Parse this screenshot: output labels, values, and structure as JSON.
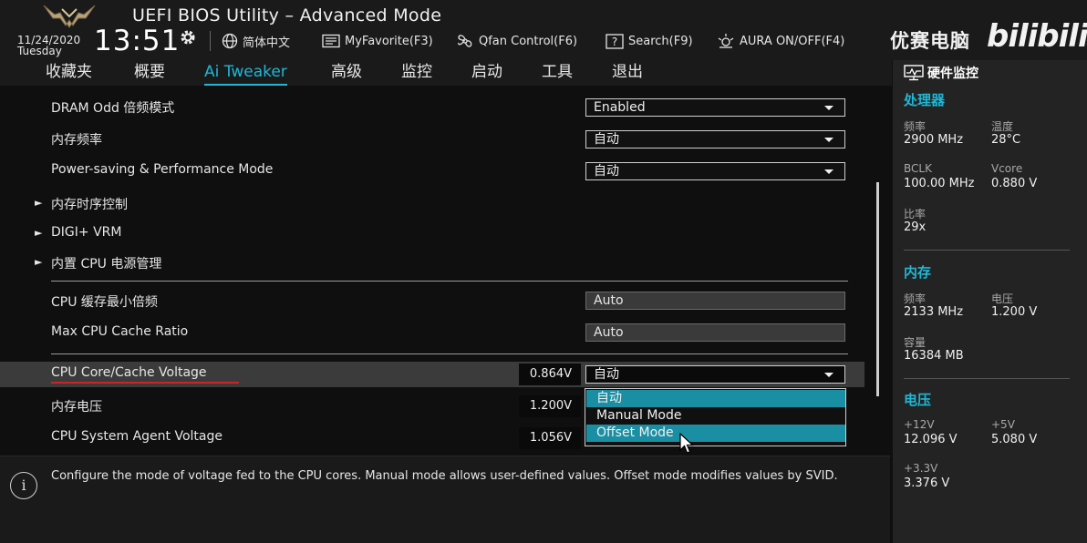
{
  "header": {
    "app_title": "UEFI BIOS Utility – Advanced Mode",
    "date": "11/24/2020",
    "day": "Tuesday",
    "time": "13:51",
    "toolbar": {
      "language": "简体中文",
      "favorite": "MyFavorite(F3)",
      "qfan": "Qfan Control(F6)",
      "search": "Search(F9)",
      "aura": "AURA ON/OFF(F4)"
    },
    "watermark": "优赛电脑",
    "watermark_brand": "bilibili"
  },
  "nav": {
    "tabs": [
      "收藏夹",
      "概要",
      "Ai Tweaker",
      "高级",
      "监控",
      "启动",
      "工具",
      "退出"
    ],
    "active": "Ai Tweaker"
  },
  "settings": {
    "dram_odd_label": "DRAM Odd 倍频模式",
    "dram_odd_value": "Enabled",
    "mem_freq_label": "内存频率",
    "mem_freq_value": "自动",
    "power_mode_label": "Power-saving & Performance Mode",
    "power_mode_value": "自动",
    "submenu_timing": "内存时序控制",
    "submenu_vrm": "DIGI+ VRM",
    "submenu_cpu_power": "内置 CPU 电源管理",
    "cpu_cache_min_label": "CPU 缓存最小倍频",
    "cpu_cache_min_value": "Auto",
    "max_cache_label": "Max CPU Cache Ratio",
    "max_cache_value": "Auto",
    "core_voltage_label": "CPU Core/Cache Voltage",
    "core_voltage_reading": "0.864V",
    "core_voltage_value": "自动",
    "mem_voltage_label": "内存电压",
    "mem_voltage_reading": "1.200V",
    "sa_voltage_label": "CPU System Agent Voltage",
    "sa_voltage_reading": "1.056V"
  },
  "popup": {
    "options": [
      "自动",
      "Manual Mode",
      "Offset Mode"
    ],
    "highlighted": [
      "自动",
      "Offset Mode"
    ]
  },
  "help": {
    "text": "Configure the mode of voltage fed to the CPU cores. Manual mode allows user-defined values. Offset mode modifies values by SVID."
  },
  "hw_monitor": {
    "title": "硬件监控",
    "cpu": {
      "title": "处理器",
      "freq_label": "频率",
      "freq_value": "2900 MHz",
      "temp_label": "温度",
      "temp_value": "28°C",
      "bclk_label": "BCLK",
      "bclk_value": "100.00 MHz",
      "vcore_label": "Vcore",
      "vcore_value": "0.880 V",
      "ratio_label": "比率",
      "ratio_value": "29x"
    },
    "memory": {
      "title": "内存",
      "freq_label": "频率",
      "freq_value": "2133 MHz",
      "volt_label": "电压",
      "volt_value": "1.200 V",
      "cap_label": "容量",
      "cap_value": "16384 MB"
    },
    "voltage": {
      "title": "电压",
      "v12_label": "+12V",
      "v12_value": "12.096 V",
      "v5_label": "+5V",
      "v5_value": "5.080 V",
      "v33_label": "+3.3V",
      "v33_value": "3.376 V"
    }
  },
  "colors": {
    "accent": "#1fb7d5",
    "highlight": "#1a8fa3",
    "underline": "#d0202a"
  }
}
